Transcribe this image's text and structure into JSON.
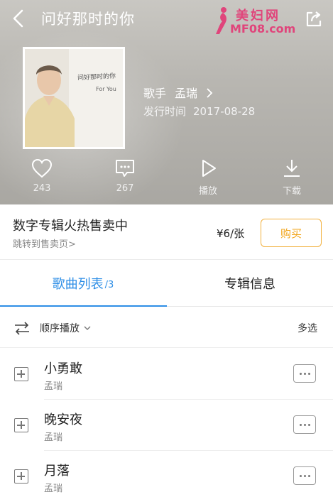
{
  "header": {
    "title": "问好那时的你",
    "watermark_line1": "美妇网",
    "watermark_line2": "MF08.com"
  },
  "album": {
    "cover_text1": "问好那时的你",
    "cover_text2": "For You",
    "artist_label": "歌手",
    "artist_name": "孟瑞",
    "release_label": "发行时间",
    "release_date": "2017-08-28"
  },
  "actions": {
    "like_count": "243",
    "comment_count": "267",
    "play_label": "播放",
    "download_label": "下载"
  },
  "promo": {
    "title": "数字专辑火热售卖中",
    "link": "跳转到售卖页>",
    "price": "¥6/张",
    "buy_label": "购买"
  },
  "tabs": {
    "songs_label": "歌曲列表",
    "songs_count": "/3",
    "info_label": "专辑信息"
  },
  "list_toolbar": {
    "order_label": "顺序播放",
    "multi_select_label": "多选"
  },
  "songs": [
    {
      "title": "小勇敢",
      "artist": "孟瑞"
    },
    {
      "title": "晚安夜",
      "artist": "孟瑞"
    },
    {
      "title": "月落",
      "artist": "孟瑞"
    }
  ],
  "colors": {
    "accent": "#2d8ee6",
    "buy_border": "#f2b13f",
    "watermark": "#e0457b"
  },
  "icons": {
    "back": "chevron-left-icon",
    "share": "share-icon",
    "like": "heart-icon",
    "comment": "comment-icon",
    "play": "play-icon",
    "download": "download-icon",
    "order": "shuffle-order-icon",
    "add": "add-icon",
    "more": "more-icon"
  }
}
